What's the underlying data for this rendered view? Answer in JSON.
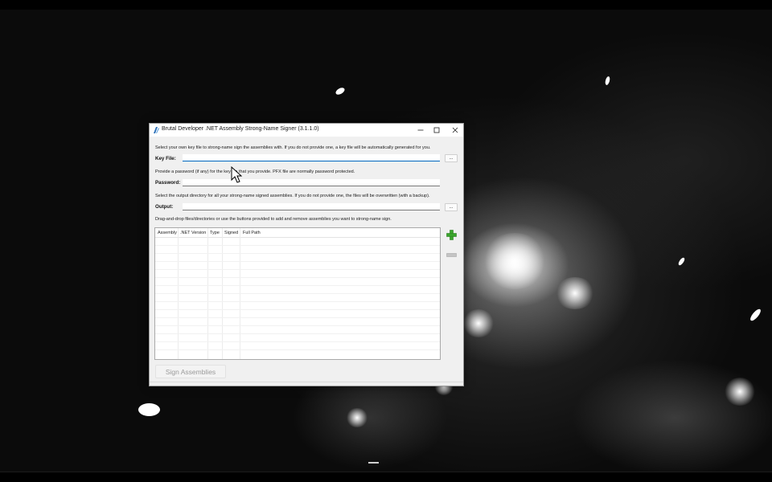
{
  "window": {
    "title": "Brutal Developer .NET Assembly Strong-Name Signer (3.1.1.0)",
    "controls": {
      "minimize": "—",
      "maximize": "☐",
      "close": "✕"
    }
  },
  "keyfile": {
    "hint": "Select your own key file to strong-name sign the assemblies with. If you do not provide one, a key file will be automatically generated for you.",
    "label": "Key File:",
    "value": "",
    "browse": "..."
  },
  "password": {
    "hint": "Provide a password (if any) for the key file that you provide. PFX file are normally password protected.",
    "label": "Password:",
    "value": ""
  },
  "output": {
    "hint": "Select the output directory for all your strong-name signed assemblies. If you do not provide one, the files will be overwritten (with a backup).",
    "label": "Output:",
    "value": "",
    "browse": "..."
  },
  "assemblies": {
    "hint": "Drag-and-drop files/directories or use the buttons provided to add and remove assemblies you want to strong-name sign.",
    "columns": [
      "Assembly",
      ".NET Version",
      "Type",
      "Signed",
      "Full Path"
    ],
    "rows": []
  },
  "actions": {
    "sign": "Sign Assemblies",
    "add_icon": "plus-icon",
    "remove_icon": "minus-icon"
  },
  "colors": {
    "accent": "#0067c0",
    "add_green": "#3aa52c",
    "remove_gray": "#b8b8b8"
  }
}
